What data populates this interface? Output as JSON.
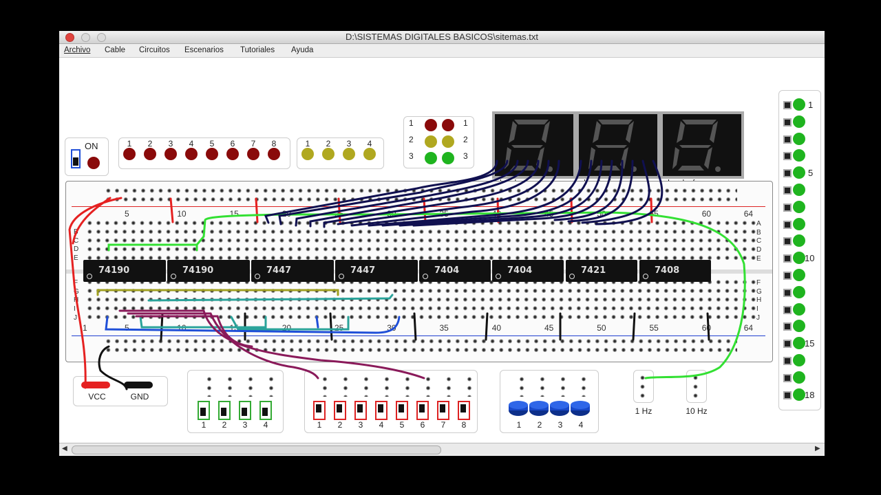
{
  "window": {
    "title": "D:\\SISTEMAS DIGITALES BASICOS\\sitemas.txt"
  },
  "menu": [
    "Archivo",
    "Cable",
    "Circuitos",
    "Escenarios",
    "Tutoriales",
    "Ayuda"
  ],
  "power": {
    "label": "ON"
  },
  "red_leds": {
    "labels": [
      "1",
      "2",
      "3",
      "4",
      "5",
      "6",
      "7",
      "8"
    ]
  },
  "yellow_leds": {
    "labels": [
      "1",
      "2",
      "3",
      "4"
    ]
  },
  "traffic": {
    "labels": [
      "1",
      "2",
      "3"
    ]
  },
  "seven_segment": {
    "pins": [
      "a",
      "b",
      "c",
      "d",
      "e",
      "f",
      "g",
      "p"
    ]
  },
  "breadboard": {
    "top_numbers": [
      "5",
      "10",
      "15",
      "20",
      "25",
      "30",
      "35",
      "40",
      "45",
      "50",
      "55",
      "60",
      "64"
    ],
    "bottom_numbers": [
      "1",
      "5",
      "10",
      "15",
      "20",
      "25",
      "30",
      "35",
      "40",
      "45",
      "50",
      "55",
      "60",
      "64"
    ],
    "rows_top": [
      "A",
      "B",
      "C",
      "D",
      "E"
    ],
    "rows_bottom": [
      "F",
      "G",
      "H",
      "I",
      "J"
    ],
    "chips": [
      "74190",
      "74190",
      "7447",
      "7447",
      "7404",
      "7404",
      "7421",
      "7408"
    ]
  },
  "supply": {
    "vcc": "VCC",
    "gnd": "GND"
  },
  "switches_a": {
    "labels": [
      "1",
      "2",
      "3",
      "4"
    ]
  },
  "switches_b": {
    "labels": [
      "1",
      "2",
      "3",
      "4",
      "5",
      "6",
      "7",
      "8"
    ]
  },
  "buttons": {
    "labels": [
      "1",
      "2",
      "3",
      "4"
    ]
  },
  "clocks": {
    "slow": "1 Hz",
    "fast": "10 Hz"
  },
  "led_column": {
    "labels": [
      "1",
      "5",
      "10",
      "15",
      "18"
    ]
  },
  "colors": {
    "wire_red": "#e52121",
    "wire_green": "#33e033",
    "wire_navy": "#101050",
    "wire_blue": "#1f4fd8",
    "wire_purple": "#8a1a5a",
    "wire_olive": "#a0a020",
    "wire_teal": "#2aa39a",
    "led_green": "#1fb41f",
    "led_red": "#8a0a0a",
    "led_yellow": "#b0a820",
    "button_blue": "#1848c8"
  }
}
